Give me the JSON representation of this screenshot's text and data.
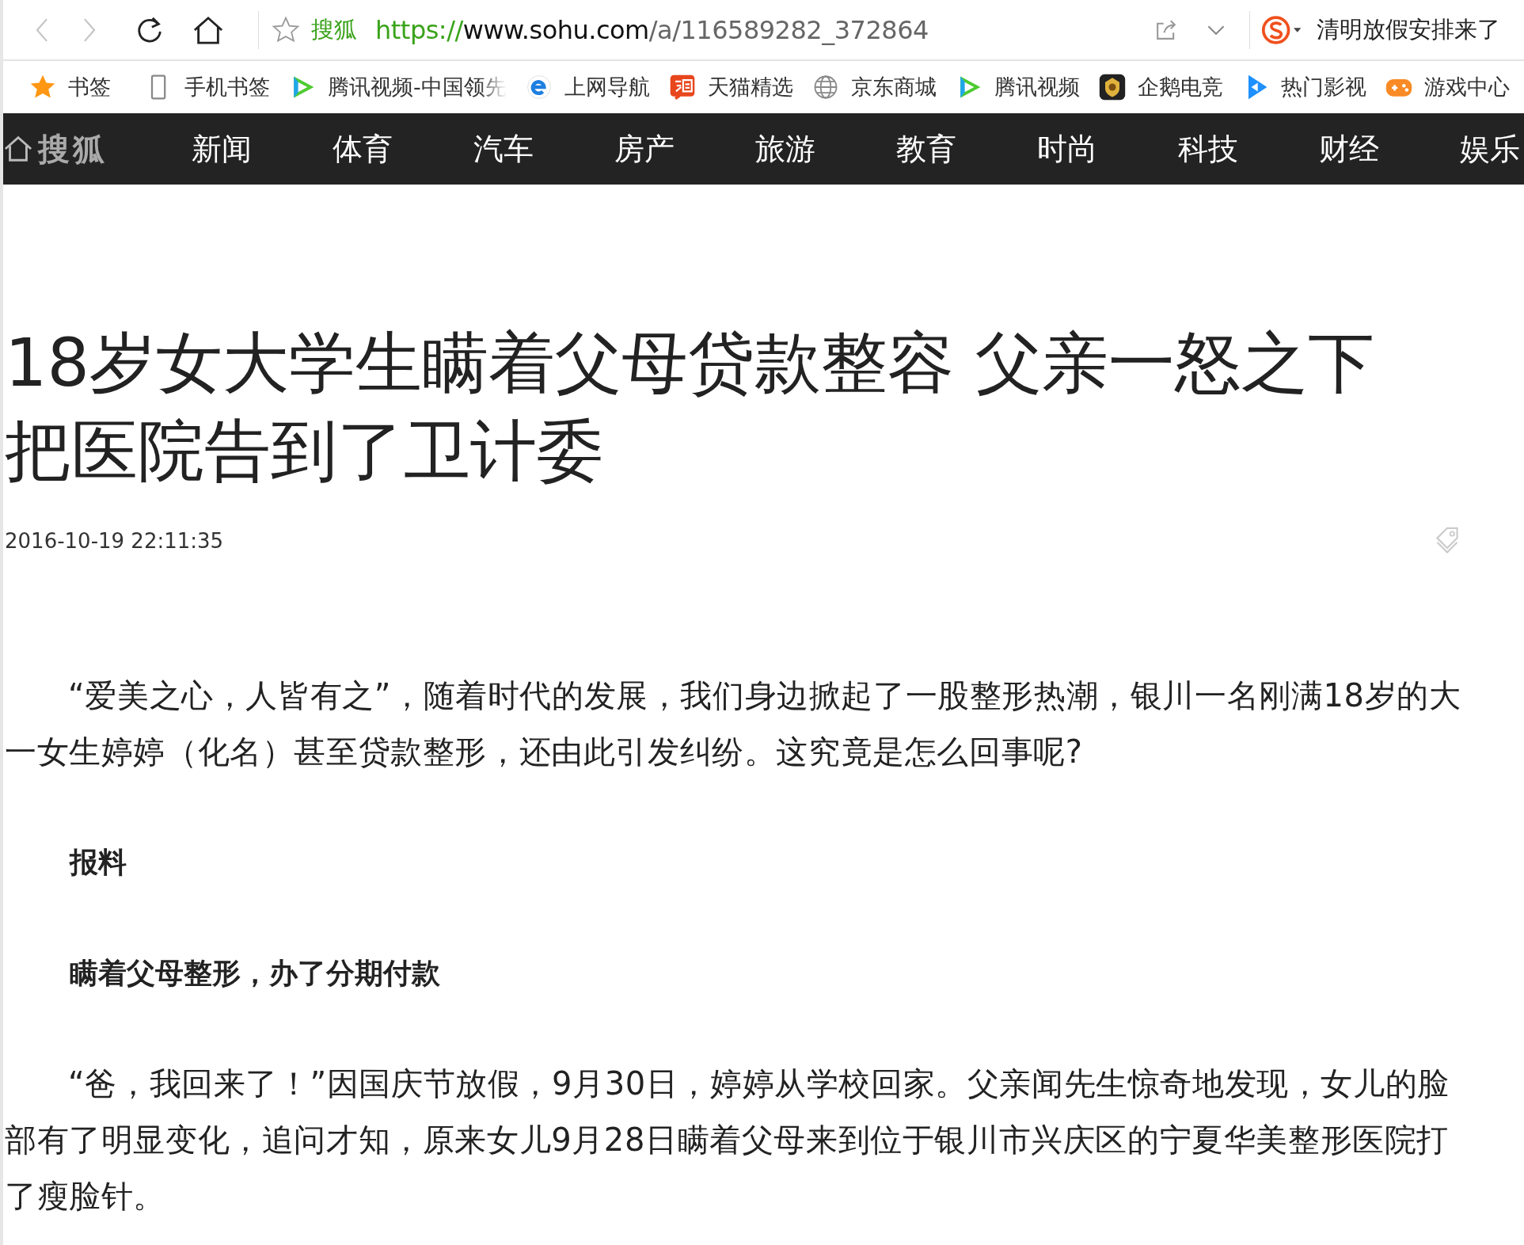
{
  "address_bar": {
    "site_label": "搜狐",
    "url_scheme": "https://",
    "url_host": "www.sohu.com",
    "url_path": "/a/116589282_372864"
  },
  "search_box": {
    "value": "清明放假安排来了"
  },
  "bookmarks": [
    {
      "label": "书签"
    },
    {
      "label": "手机书签"
    },
    {
      "label": "腾讯视频-中国领先"
    },
    {
      "label": "上网导航"
    },
    {
      "label": "天猫精选"
    },
    {
      "label": "京东商城"
    },
    {
      "label": "腾讯视频"
    },
    {
      "label": "企鹅电竞"
    },
    {
      "label": "热门影视"
    },
    {
      "label": "游戏中心"
    }
  ],
  "site_nav": {
    "logo": "搜狐",
    "items": [
      "新闻",
      "体育",
      "汽车",
      "房产",
      "旅游",
      "教育",
      "时尚",
      "科技",
      "财经",
      "娱乐"
    ]
  },
  "article": {
    "title": "18岁女大学生瞒着父母贷款整容 父亲一怒之下把医院告到了卫计委",
    "date": "2016-10-19 22:11:35",
    "blocks": [
      {
        "kind": "paragraph",
        "text": "“爱美之心，人皆有之”，随着时代的发展，我们身边掀起了一股整形热潮，银川一名刚满18岁的大一女生婷婷（化名）甚至贷款整形，还由此引发纠纷。这究竟是怎么回事呢?"
      },
      {
        "kind": "heading",
        "text": "报料"
      },
      {
        "kind": "heading",
        "text": "瞒着父母整形，办了分期付款"
      },
      {
        "kind": "paragraph",
        "text": "“爸，我回来了！”因国庆节放假，9月30日，婷婷从学校回家。父亲闻先生惊奇地发现，女儿的脸部有了明显变化，追问才知，原来女儿9月28日瞒着父母来到位于银川市兴庆区的宁夏华美整形医院打了瘦脸针。"
      }
    ]
  }
}
